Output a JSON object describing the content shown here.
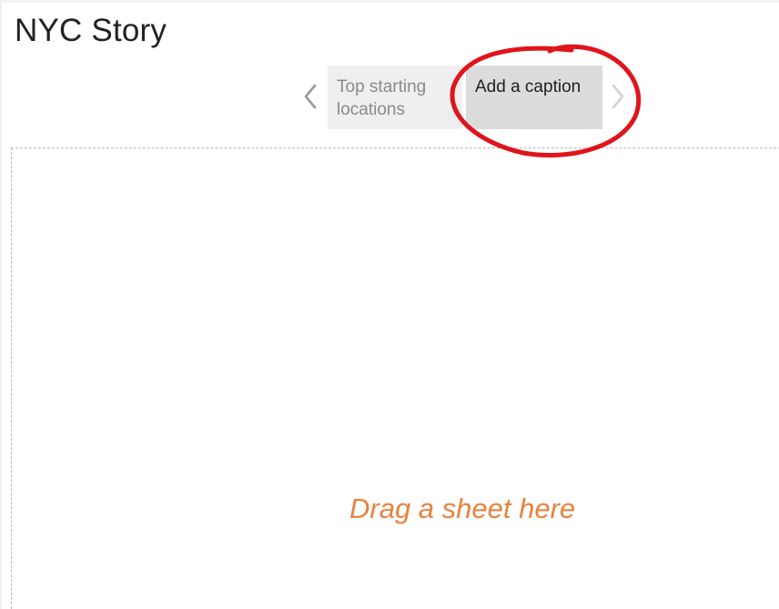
{
  "story": {
    "title": "NYC Story"
  },
  "navigator": {
    "points": [
      {
        "label": "Top starting locations",
        "selected": false
      },
      {
        "label": "Add a caption",
        "selected": true
      }
    ],
    "prev_icon": "chevron-left-icon",
    "next_icon": "chevron-right-icon"
  },
  "canvas": {
    "drop_hint": "Drag a sheet here"
  },
  "colors": {
    "drop_hint": "#e8823d",
    "annotation": "#e0141b",
    "point_active_bg": "#dcdcdc",
    "point_inactive_bg": "#efefef"
  }
}
